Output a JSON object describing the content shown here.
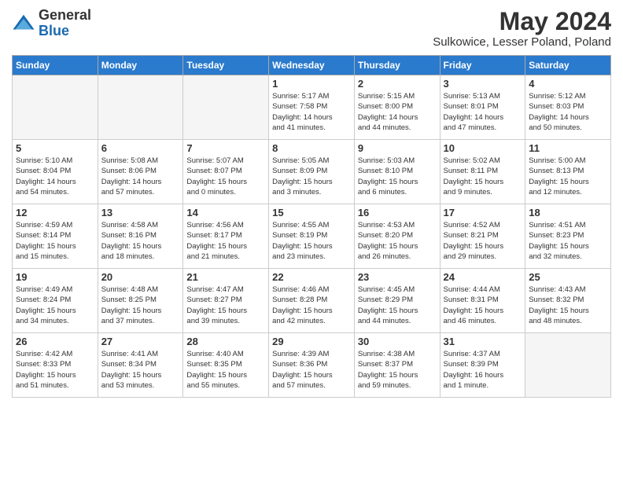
{
  "logo": {
    "general": "General",
    "blue": "Blue"
  },
  "header": {
    "month": "May 2024",
    "location": "Sulkowice, Lesser Poland, Poland"
  },
  "days_of_week": [
    "Sunday",
    "Monday",
    "Tuesday",
    "Wednesday",
    "Thursday",
    "Friday",
    "Saturday"
  ],
  "weeks": [
    [
      {
        "day": "",
        "info": ""
      },
      {
        "day": "",
        "info": ""
      },
      {
        "day": "",
        "info": ""
      },
      {
        "day": "1",
        "info": "Sunrise: 5:17 AM\nSunset: 7:58 PM\nDaylight: 14 hours\nand 41 minutes."
      },
      {
        "day": "2",
        "info": "Sunrise: 5:15 AM\nSunset: 8:00 PM\nDaylight: 14 hours\nand 44 minutes."
      },
      {
        "day": "3",
        "info": "Sunrise: 5:13 AM\nSunset: 8:01 PM\nDaylight: 14 hours\nand 47 minutes."
      },
      {
        "day": "4",
        "info": "Sunrise: 5:12 AM\nSunset: 8:03 PM\nDaylight: 14 hours\nand 50 minutes."
      }
    ],
    [
      {
        "day": "5",
        "info": "Sunrise: 5:10 AM\nSunset: 8:04 PM\nDaylight: 14 hours\nand 54 minutes."
      },
      {
        "day": "6",
        "info": "Sunrise: 5:08 AM\nSunset: 8:06 PM\nDaylight: 14 hours\nand 57 minutes."
      },
      {
        "day": "7",
        "info": "Sunrise: 5:07 AM\nSunset: 8:07 PM\nDaylight: 15 hours\nand 0 minutes."
      },
      {
        "day": "8",
        "info": "Sunrise: 5:05 AM\nSunset: 8:09 PM\nDaylight: 15 hours\nand 3 minutes."
      },
      {
        "day": "9",
        "info": "Sunrise: 5:03 AM\nSunset: 8:10 PM\nDaylight: 15 hours\nand 6 minutes."
      },
      {
        "day": "10",
        "info": "Sunrise: 5:02 AM\nSunset: 8:11 PM\nDaylight: 15 hours\nand 9 minutes."
      },
      {
        "day": "11",
        "info": "Sunrise: 5:00 AM\nSunset: 8:13 PM\nDaylight: 15 hours\nand 12 minutes."
      }
    ],
    [
      {
        "day": "12",
        "info": "Sunrise: 4:59 AM\nSunset: 8:14 PM\nDaylight: 15 hours\nand 15 minutes."
      },
      {
        "day": "13",
        "info": "Sunrise: 4:58 AM\nSunset: 8:16 PM\nDaylight: 15 hours\nand 18 minutes."
      },
      {
        "day": "14",
        "info": "Sunrise: 4:56 AM\nSunset: 8:17 PM\nDaylight: 15 hours\nand 21 minutes."
      },
      {
        "day": "15",
        "info": "Sunrise: 4:55 AM\nSunset: 8:19 PM\nDaylight: 15 hours\nand 23 minutes."
      },
      {
        "day": "16",
        "info": "Sunrise: 4:53 AM\nSunset: 8:20 PM\nDaylight: 15 hours\nand 26 minutes."
      },
      {
        "day": "17",
        "info": "Sunrise: 4:52 AM\nSunset: 8:21 PM\nDaylight: 15 hours\nand 29 minutes."
      },
      {
        "day": "18",
        "info": "Sunrise: 4:51 AM\nSunset: 8:23 PM\nDaylight: 15 hours\nand 32 minutes."
      }
    ],
    [
      {
        "day": "19",
        "info": "Sunrise: 4:49 AM\nSunset: 8:24 PM\nDaylight: 15 hours\nand 34 minutes."
      },
      {
        "day": "20",
        "info": "Sunrise: 4:48 AM\nSunset: 8:25 PM\nDaylight: 15 hours\nand 37 minutes."
      },
      {
        "day": "21",
        "info": "Sunrise: 4:47 AM\nSunset: 8:27 PM\nDaylight: 15 hours\nand 39 minutes."
      },
      {
        "day": "22",
        "info": "Sunrise: 4:46 AM\nSunset: 8:28 PM\nDaylight: 15 hours\nand 42 minutes."
      },
      {
        "day": "23",
        "info": "Sunrise: 4:45 AM\nSunset: 8:29 PM\nDaylight: 15 hours\nand 44 minutes."
      },
      {
        "day": "24",
        "info": "Sunrise: 4:44 AM\nSunset: 8:31 PM\nDaylight: 15 hours\nand 46 minutes."
      },
      {
        "day": "25",
        "info": "Sunrise: 4:43 AM\nSunset: 8:32 PM\nDaylight: 15 hours\nand 48 minutes."
      }
    ],
    [
      {
        "day": "26",
        "info": "Sunrise: 4:42 AM\nSunset: 8:33 PM\nDaylight: 15 hours\nand 51 minutes."
      },
      {
        "day": "27",
        "info": "Sunrise: 4:41 AM\nSunset: 8:34 PM\nDaylight: 15 hours\nand 53 minutes."
      },
      {
        "day": "28",
        "info": "Sunrise: 4:40 AM\nSunset: 8:35 PM\nDaylight: 15 hours\nand 55 minutes."
      },
      {
        "day": "29",
        "info": "Sunrise: 4:39 AM\nSunset: 8:36 PM\nDaylight: 15 hours\nand 57 minutes."
      },
      {
        "day": "30",
        "info": "Sunrise: 4:38 AM\nSunset: 8:37 PM\nDaylight: 15 hours\nand 59 minutes."
      },
      {
        "day": "31",
        "info": "Sunrise: 4:37 AM\nSunset: 8:39 PM\nDaylight: 16 hours\nand 1 minute."
      },
      {
        "day": "",
        "info": ""
      }
    ]
  ]
}
